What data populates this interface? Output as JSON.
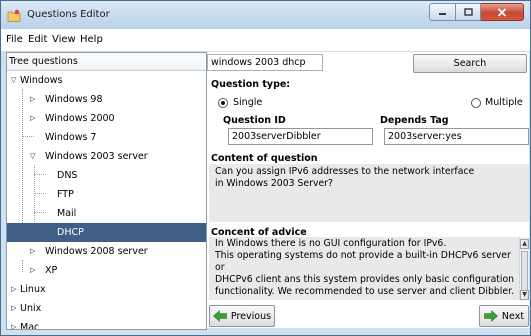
{
  "window": {
    "title": "Questions Editor"
  },
  "menu": [
    "File",
    "Edit",
    "View",
    "Help"
  ],
  "tree": {
    "header": "Tree questions",
    "items": [
      {
        "label": "Windows",
        "toggle": "open"
      },
      {
        "label": "Windows 98",
        "toggle": "closed"
      },
      {
        "label": "Windows 2000",
        "toggle": "closed"
      },
      {
        "label": "Windows 7",
        "toggle": "none"
      },
      {
        "label": "Windows 2003 server",
        "toggle": "open"
      },
      {
        "label": "DNS",
        "toggle": "none"
      },
      {
        "label": "FTP",
        "toggle": "none"
      },
      {
        "label": "Mail",
        "toggle": "none"
      },
      {
        "label": "DHCP",
        "toggle": "none",
        "selected": true
      },
      {
        "label": "Windows 2008 server",
        "toggle": "closed"
      },
      {
        "label": "XP",
        "toggle": "closed"
      },
      {
        "label": "Linux",
        "toggle": "closed"
      },
      {
        "label": "Unix",
        "toggle": "closed"
      },
      {
        "label": "Mac",
        "toggle": "closed"
      }
    ]
  },
  "search": {
    "value": "windows 2003 dhcp",
    "button": "Search"
  },
  "question": {
    "type_label": "Question type:",
    "single_label": "Single",
    "multiple_label": "Multiple",
    "selected_type": "Single",
    "id_label": "Question ID",
    "id_value": "2003serverDibbler",
    "depends_label": "Depends Tag",
    "depends_value": "2003server:yes",
    "content_label": "Content of question",
    "content": "Can you assign IPv6 addresses to the network interface\nin Windows 2003 Server?",
    "advice_label": "Concent of advice",
    "advice": "In Windows there is no GUI configuration for IPv6.\nThis operating systems do not provide a built-in DHCPv6 server or\nDHCPv6 client ans this system provides only basic configuration\nfunctionality. We recommended to use server and client Dibbler."
  },
  "nav": {
    "previous": "Previous",
    "next": "Next"
  },
  "colors": {
    "selection": "#3f5f86",
    "titlebar": "#c4d8ee",
    "close": "#c74a32",
    "arrow": "#3aa03a"
  }
}
